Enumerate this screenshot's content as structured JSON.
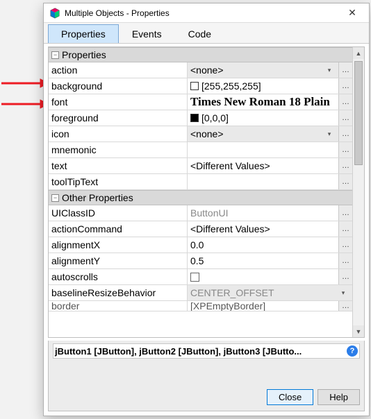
{
  "window": {
    "title": "Multiple Objects - Properties"
  },
  "tabs": {
    "properties": "Properties",
    "events": "Events",
    "code": "Code"
  },
  "sections": {
    "properties": "Properties",
    "other": "Other Properties"
  },
  "props": {
    "action": {
      "name": "action",
      "value": "<none>",
      "combo": true,
      "ellipsis": true
    },
    "background": {
      "name": "background",
      "value": "[255,255,255]",
      "swatch": "#ffffff",
      "ellipsis": true
    },
    "font": {
      "name": "font",
      "value": "Times New Roman 18 Plain",
      "font_style": true,
      "ellipsis": true
    },
    "foreground": {
      "name": "foreground",
      "value": "[0,0,0]",
      "swatch": "#000000",
      "ellipsis": true
    },
    "icon": {
      "name": "icon",
      "value": "<none>",
      "combo": true,
      "ellipsis": true
    },
    "mnemonic": {
      "name": "mnemonic",
      "value": "",
      "ellipsis": true
    },
    "text": {
      "name": "text",
      "value": "<Different Values>",
      "ellipsis": true
    },
    "toolTipText": {
      "name": "toolTipText",
      "value": "",
      "ellipsis": true
    }
  },
  "other": {
    "UIClassID": {
      "name": "UIClassID",
      "value": "ButtonUI",
      "readonly": true,
      "ellipsis": true
    },
    "actionCommand": {
      "name": "actionCommand",
      "value": "<Different Values>",
      "ellipsis": true
    },
    "alignmentX": {
      "name": "alignmentX",
      "value": "0.0",
      "ellipsis": true
    },
    "alignmentY": {
      "name": "alignmentY",
      "value": "0.5",
      "ellipsis": true
    },
    "autoscrolls": {
      "name": "autoscrolls",
      "checkbox": true,
      "checked": false,
      "ellipsis": true
    },
    "baselineResizeBehavior": {
      "name": "baselineResizeBehavior",
      "value": "CENTER_OFFSET",
      "readonly": true,
      "combo": true,
      "ellipsis": false
    },
    "border": {
      "name": "border",
      "value": "[XPEmptyBorder]",
      "ellipsis": true
    }
  },
  "selection": "jButton1 [JButton], jButton2 [JButton], jButton3 [JButto...",
  "buttons": {
    "close": "Close",
    "help": "Help"
  }
}
